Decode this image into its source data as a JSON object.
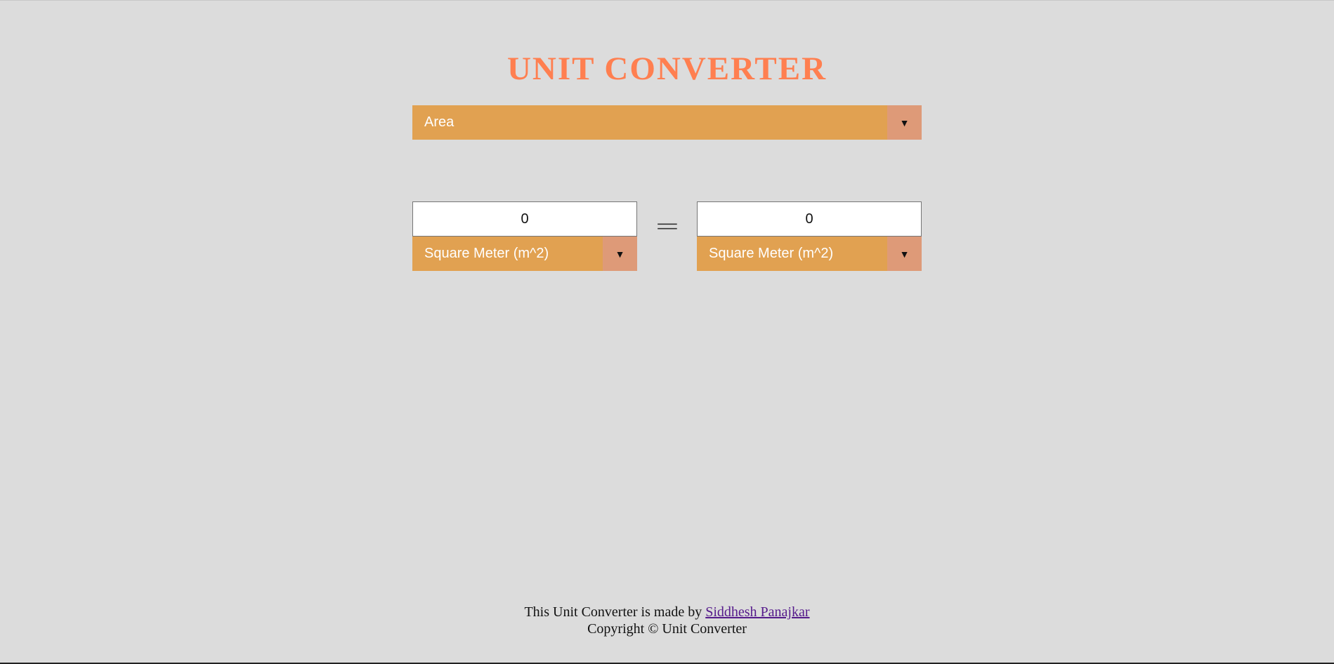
{
  "header": {
    "title": "UNIT CONVERTER"
  },
  "category": {
    "selected": "Area"
  },
  "converter": {
    "left": {
      "value": "0",
      "unit": "Square Meter (m^2)"
    },
    "right": {
      "value": "0",
      "unit": "Square Meter (m^2)"
    },
    "equals_symbol": "="
  },
  "footer": {
    "made_by_text": "This Unit Converter is made by ",
    "author_link": "Siddhesh Panajkar",
    "copyright": "Copyright © Unit Converter"
  },
  "icons": {
    "dropdown_arrow": "▼"
  },
  "colors": {
    "background": "#dcdcdc",
    "title": "#ff7f50",
    "select_bg": "#e1a151",
    "select_arrow_bg": "#de9a78",
    "link": "#551a8b"
  }
}
